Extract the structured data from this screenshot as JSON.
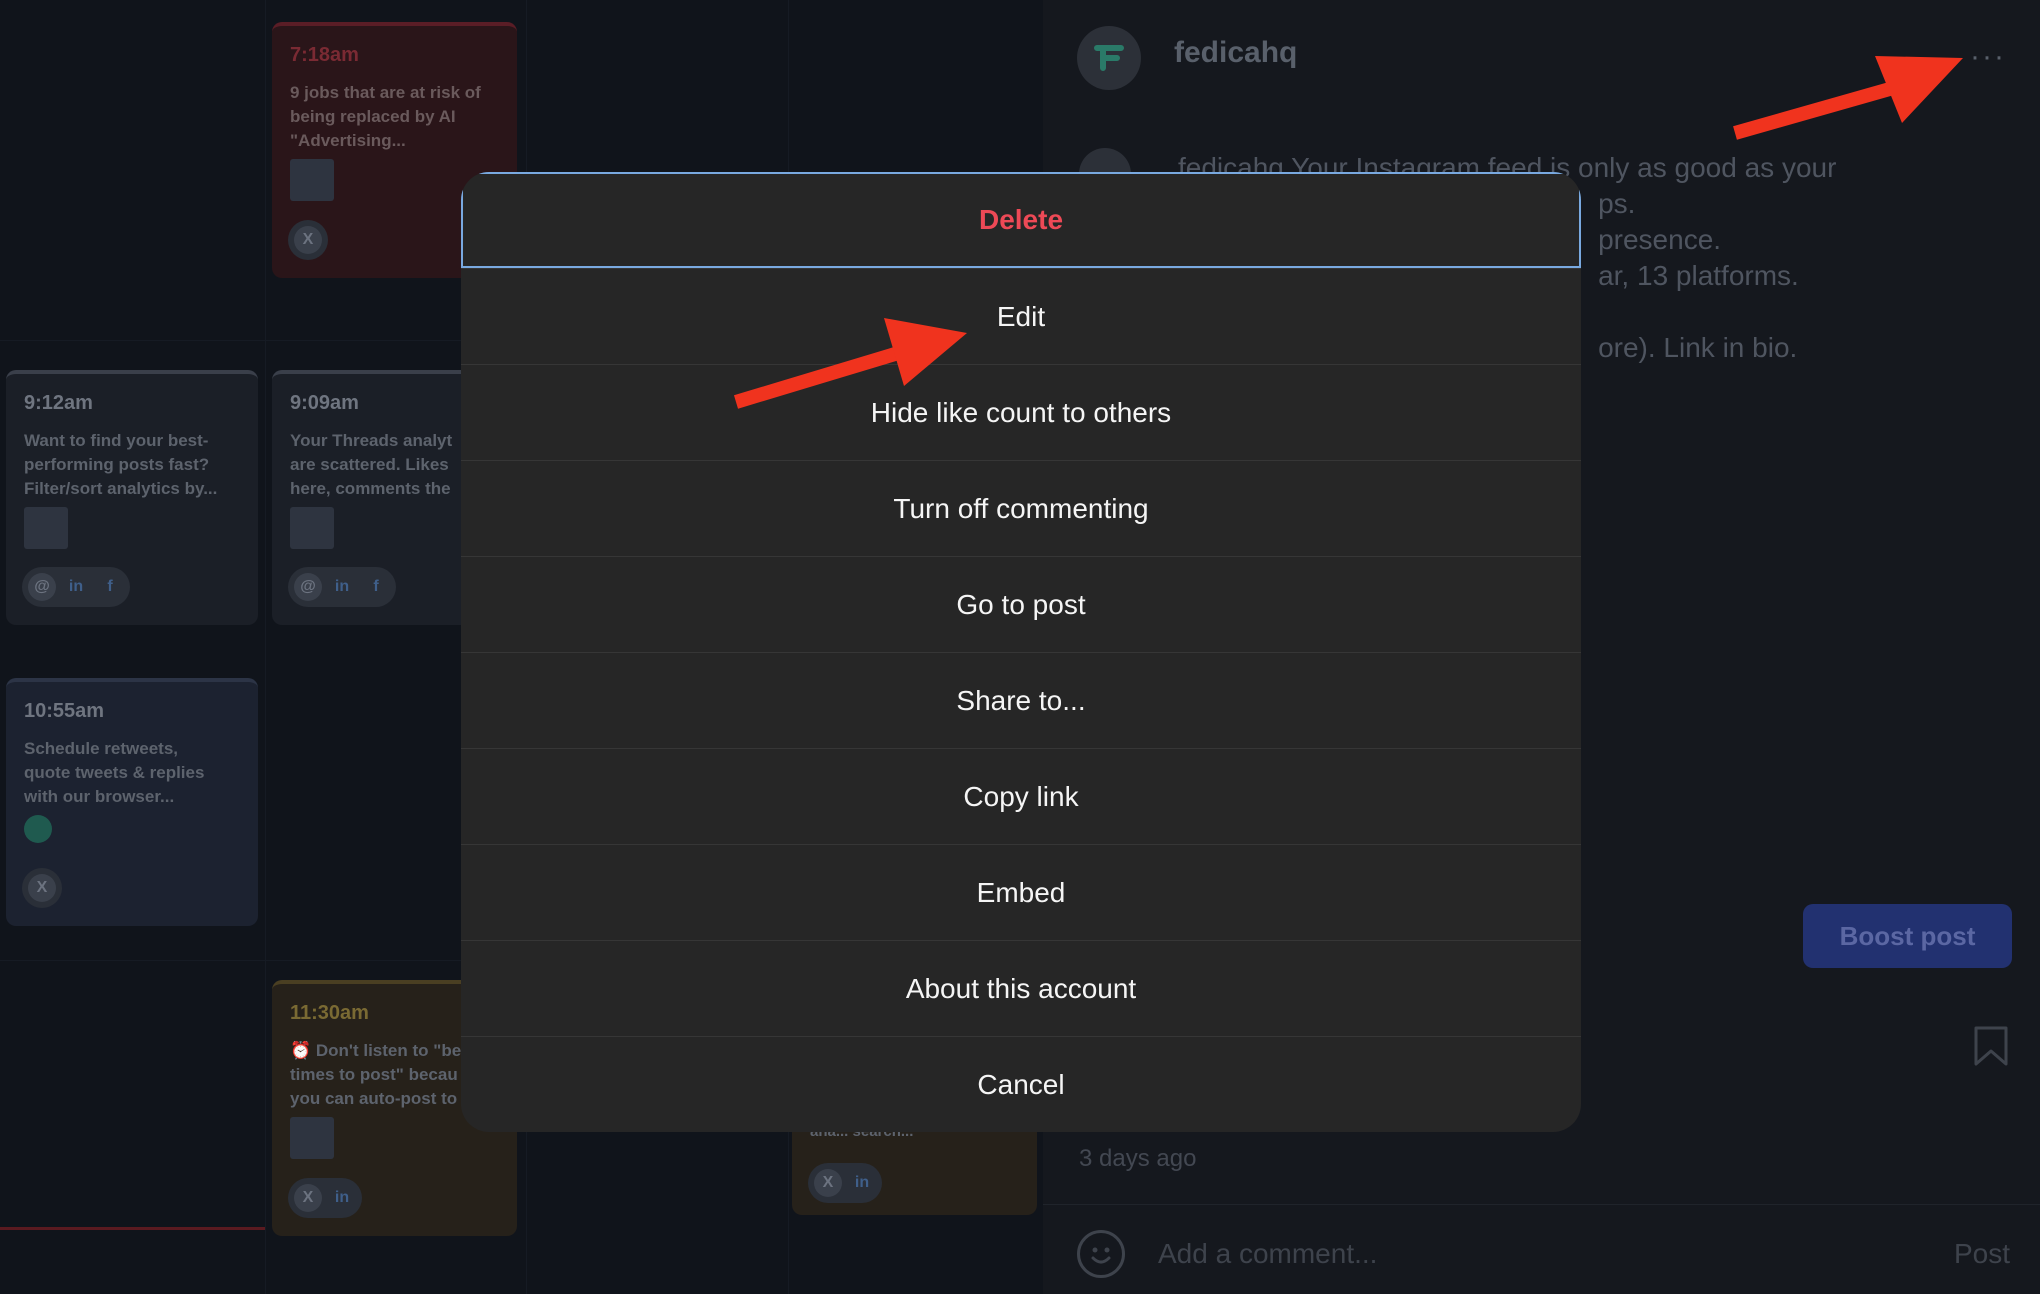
{
  "calendar": {
    "cards": [
      {
        "time": "7:18am",
        "lines": [
          "9 jobs that are at risk of",
          "being replaced by AI",
          "\"Advertising..."
        ],
        "icons": [
          "X"
        ]
      },
      {
        "time": "9:12am",
        "lines": [
          "Want to find your best-",
          "performing posts fast?",
          "Filter/sort analytics by..."
        ],
        "icons": [
          "@",
          "in",
          "f"
        ]
      },
      {
        "time": "9:09am",
        "lines": [
          "Your Threads analyt",
          "are scattered. Likes",
          "here, comments the"
        ],
        "icons": [
          "@",
          "in",
          "f"
        ]
      },
      {
        "time": "10:55am",
        "lines": [
          "Schedule retweets,",
          "quote tweets & replies",
          "with our browser..."
        ],
        "icons": [
          "X"
        ]
      },
      {
        "time": "11:30am",
        "lines": [
          "⏰ Don't listen to \"be",
          "times to post\" becau",
          "you can auto-post to"
        ],
        "icons": [
          "X",
          "in"
        ]
      },
      {
        "time": "",
        "lines": [
          "ana... search..."
        ],
        "icons": [
          "X",
          "in"
        ]
      }
    ]
  },
  "panel": {
    "username": "fedicahq",
    "more_icon": "···",
    "caption_lines": [
      "fedicahq Your Instagram feed is only as good as your",
      "                                                      ps.",
      "                                                      presence.",
      "                                                      ar, 13 platforms.",
      "",
      "                                                      ore). Link in bio."
    ],
    "boost_label": "Boost post",
    "time_ago": "3 days ago",
    "comment_placeholder": "Add a comment...",
    "post_label": "Post"
  },
  "menu": {
    "items": [
      "Delete",
      "Edit",
      "Hide like count to others",
      "Turn off commenting",
      "Go to post",
      "Share to...",
      "Copy link",
      "Embed",
      "About this account",
      "Cancel"
    ]
  },
  "colors": {
    "delete": "#ed4956",
    "arrow": "#f0331e",
    "modal_bg": "#262626",
    "boost_bg": "#223170"
  },
  "icons": {
    "more": "more-options-icon",
    "bookmark": "bookmark-icon",
    "emoji": "emoji-icon",
    "arrow": "red-arrow-annotation"
  }
}
